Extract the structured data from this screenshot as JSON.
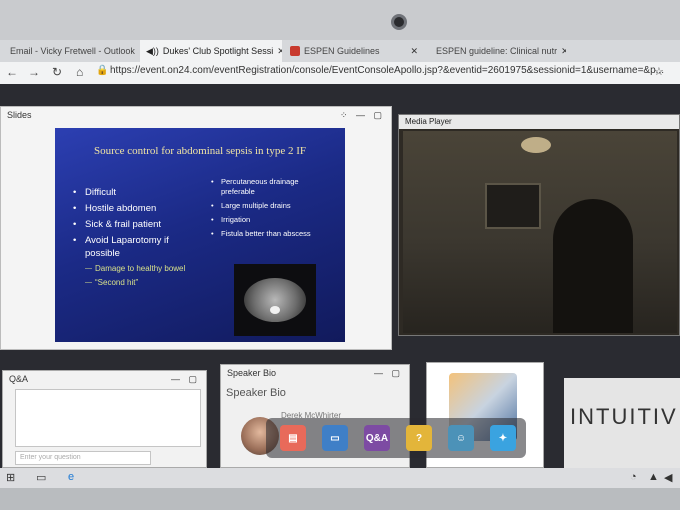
{
  "browser": {
    "tabs": [
      {
        "label": "Email - Vicky Fretwell - Outlook",
        "icon": "mail-icon"
      },
      {
        "label": "Dukes' Club Spotlight Sessi",
        "icon": "speaker-icon"
      },
      {
        "label": "ESPEN Guidelines",
        "icon": "document-icon"
      },
      {
        "label": "ESPEN guideline: Clinical nutr",
        "icon": "document-icon"
      }
    ],
    "close_glyph": "✕",
    "url": "https://event.on24.com/eventRegistration/console/EventConsoleApollo.jsp?&eventid=2601975&sessionid=1&username=&p..."
  },
  "slides_panel": {
    "title": "Slides",
    "slide": {
      "title": "Source control for abdominal sepsis in type 2 IF",
      "left_bullets": [
        "Difficult",
        "Hostile abdomen",
        "Sick & frail patient",
        "Avoid Laparotomy if possible"
      ],
      "sub_bullets": [
        "Damage to healthy bowel",
        "“Second hit”"
      ],
      "right_bullets": [
        "Percutaneous drainage preferable",
        "Large multiple drains",
        "Irrigation",
        "Fistula better than abscess"
      ]
    }
  },
  "media_panel": {
    "title": "Media Player"
  },
  "qa_panel": {
    "title": "Q&A",
    "input_placeholder": "Enter your question"
  },
  "bio_panel": {
    "title": "Speaker Bio",
    "heading": "Speaker Bio",
    "speaker_name": "Derek McWhirter"
  },
  "brand": {
    "text": "INTUITIV"
  },
  "toolbar": {
    "items": [
      {
        "icon": "slides-icon",
        "color": "#e86a5a"
      },
      {
        "icon": "presentation-icon",
        "color": "#3f7fc7"
      },
      {
        "label": "Q&A",
        "color": "#7d4ba3"
      },
      {
        "label": "?",
        "color": "#e3b53a"
      },
      {
        "icon": "person-icon",
        "color": "#4c92b8"
      },
      {
        "icon": "twitter-icon",
        "color": "#3aa3e0"
      }
    ]
  }
}
